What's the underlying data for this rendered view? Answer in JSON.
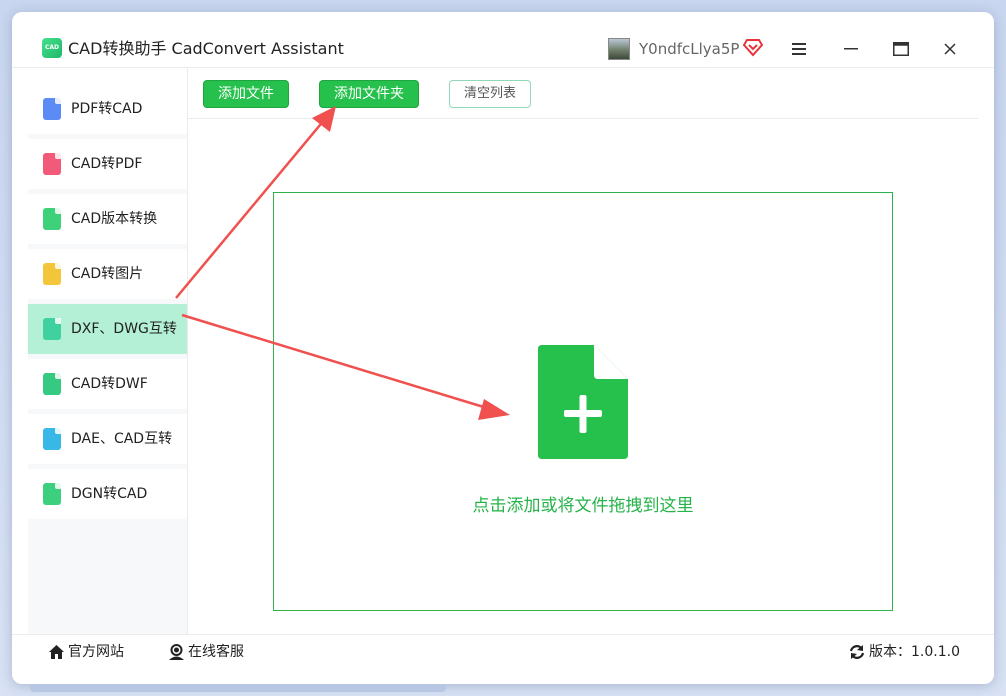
{
  "app": {
    "title": "CAD转换助手 CadConvert Assistant",
    "logo_text": "CAD",
    "username": "Y0ndfcLlya5P"
  },
  "sidebar": {
    "items": [
      {
        "label": "PDF转CAD",
        "icon": "pdf-to-cad-icon",
        "color": "#5b8cf5"
      },
      {
        "label": "CAD转PDF",
        "icon": "cad-to-pdf-icon",
        "color": "#f25a7a"
      },
      {
        "label": "CAD版本转换",
        "icon": "cad-version-icon",
        "color": "#3fd17a"
      },
      {
        "label": "CAD转图片",
        "icon": "cad-to-image-icon",
        "color": "#f2c53a"
      },
      {
        "label": "DXF、DWG互转",
        "icon": "dxf-dwg-icon",
        "color": "#3fd1a0"
      },
      {
        "label": "CAD转DWF",
        "icon": "cad-to-dwf-icon",
        "color": "#36c982"
      },
      {
        "label": "DAE、CAD互转",
        "icon": "dae-cad-icon",
        "color": "#38b8e6"
      },
      {
        "label": "DGN转CAD",
        "icon": "dgn-to-cad-icon",
        "color": "#3ccf7e"
      }
    ],
    "active_index": 4
  },
  "toolbar": {
    "add_file": "添加文件",
    "add_folder": "添加文件夹",
    "clear_list": "清空列表"
  },
  "dropzone": {
    "text": "点击添加或将文件拖拽到这里",
    "icon": "add-file-icon"
  },
  "statusbar": {
    "website": "官方网站",
    "support": "在线客服",
    "version_label": "版本：1.0.1.0"
  },
  "colors": {
    "accent": "#25c14c",
    "active_item": "#b3f0d6",
    "arrow": "#f0504e"
  }
}
